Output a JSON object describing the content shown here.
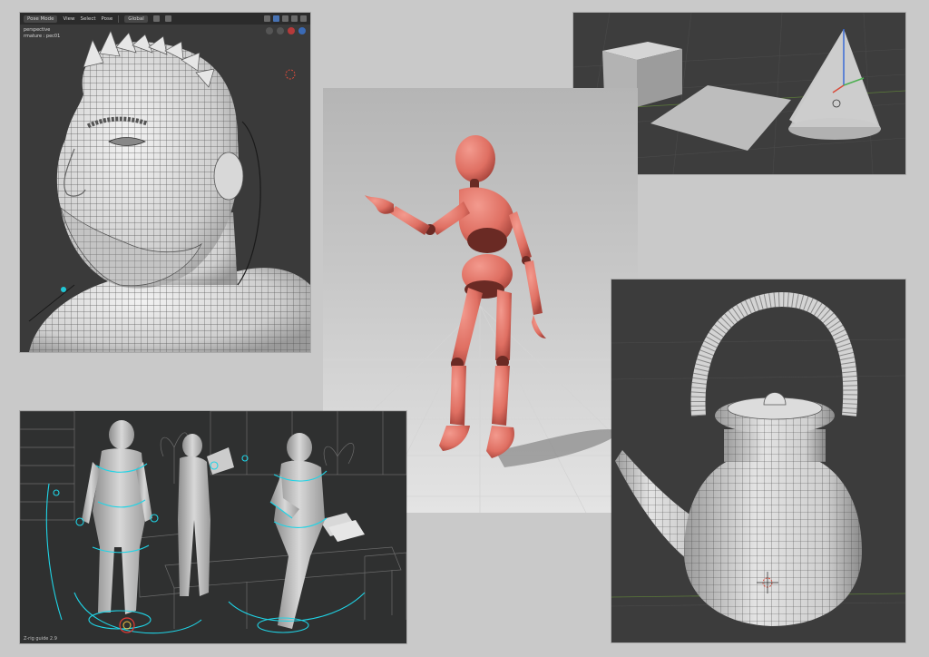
{
  "viewport_head": {
    "mode_label": "Pose Mode",
    "menu": [
      "View",
      "Select",
      "Pose"
    ],
    "orientation_label": "Global",
    "overlay_lines": [
      "perspective",
      "rmature : pec01"
    ]
  },
  "viewport_chars": {
    "footer_label": "Z-rig guide 2.9"
  },
  "colors": {
    "page_bg": "#c9c9c9",
    "viewport_bg": "#3b3b3b",
    "mannequin_red": "#e07467",
    "mannequin_joint": "#6a2a24",
    "rig_cyan": "#1fd4e6",
    "blender_blue": "#4772b3",
    "mesh_grey": "#d9d9d9"
  }
}
